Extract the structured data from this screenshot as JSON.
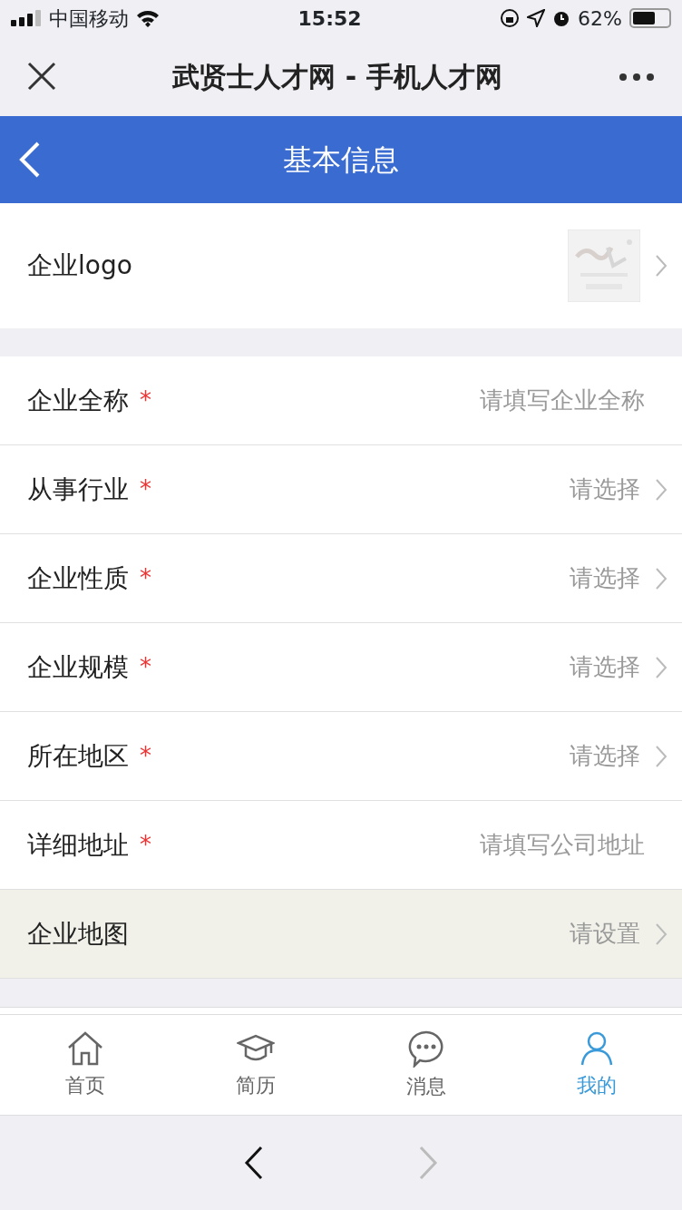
{
  "status_bar": {
    "carrier": "中国移动",
    "time": "15:52",
    "battery": "62%"
  },
  "browser_bar": {
    "title": "武贤士人才网 - 手机人才网"
  },
  "header": {
    "title": "基本信息"
  },
  "logo_row": {
    "label": "企业logo"
  },
  "fields": [
    {
      "label": "企业全称",
      "required_mark": "*",
      "kind": "input",
      "placeholder": "请填写企业全称",
      "highlighted": false
    },
    {
      "label": "从事行业",
      "required_mark": "*",
      "kind": "select",
      "placeholder": "请选择",
      "highlighted": false
    },
    {
      "label": "企业性质",
      "required_mark": "*",
      "kind": "select",
      "placeholder": "请选择",
      "highlighted": false
    },
    {
      "label": "企业规模",
      "required_mark": "*",
      "kind": "select",
      "placeholder": "请选择",
      "highlighted": false
    },
    {
      "label": "所在地区",
      "required_mark": "*",
      "kind": "select",
      "placeholder": "请选择",
      "highlighted": false
    },
    {
      "label": "详细地址",
      "required_mark": "*",
      "kind": "input",
      "placeholder": "请填写公司地址",
      "highlighted": false
    },
    {
      "label": "企业地图",
      "kind": "select",
      "placeholder": "请设置",
      "highlighted": true
    }
  ],
  "tabs": [
    {
      "label": "首页",
      "selected": false
    },
    {
      "label": "简历",
      "selected": false
    },
    {
      "label": "消息",
      "selected": false
    },
    {
      "label": "我的",
      "selected": true
    }
  ],
  "browser_nav": {
    "back_enabled": true,
    "forward_enabled": false
  }
}
